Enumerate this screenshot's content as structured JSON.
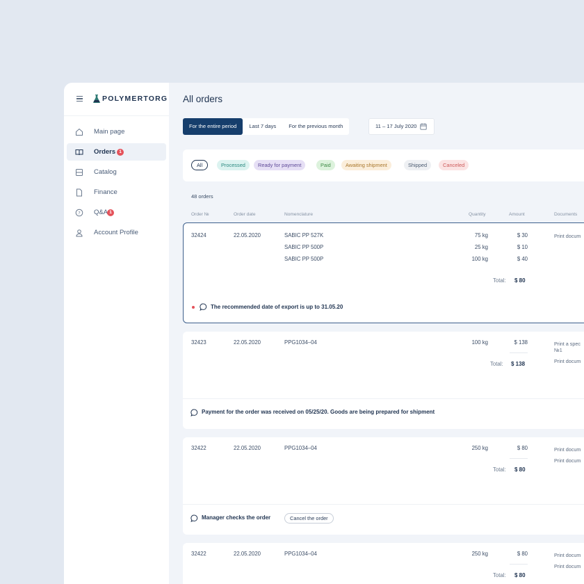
{
  "app": {
    "logo_text": "POLYMERTORG"
  },
  "sidebar": {
    "items": [
      {
        "label": "Main page",
        "icon": "home-icon"
      },
      {
        "label": "Orders",
        "icon": "book-icon",
        "badge": "1",
        "active": true
      },
      {
        "label": "Catalog",
        "icon": "catalog-icon"
      },
      {
        "label": "Finance",
        "icon": "file-icon"
      },
      {
        "label": "Q&A",
        "icon": "question-icon",
        "badge": "1"
      },
      {
        "label": "Account Profile",
        "icon": "user-icon"
      }
    ]
  },
  "main": {
    "title": "All orders",
    "periods": [
      "For the entire period",
      "Last 7 days",
      "For the previous month"
    ],
    "date_range": "11 – 17 July 2020",
    "filters": [
      "All",
      "Processed",
      "Ready for payment",
      "Paid",
      "Awaiting shipment",
      "Shipped",
      "Canceled"
    ],
    "orders_count": "48 orders",
    "columns": [
      "Order №",
      "Order date",
      "Nomenclature",
      "Quantity",
      "Amount",
      "Documents"
    ],
    "total_label": "Total:"
  },
  "colors": {
    "accent": "#163e6c",
    "badge_red": "#e4525a",
    "chip_processed_bg": "#dcf3f0",
    "chip_ready_bg": "#e6dff5",
    "chip_paid_bg": "#dcf2dc",
    "chip_awaiting_bg": "#fbeedb",
    "chip_shipped_bg": "#eef0f3",
    "chip_canceled_bg": "#fbe3e3"
  },
  "orders": [
    {
      "number": "32424",
      "date": "22.05.2020",
      "items": [
        {
          "name": "SABIC PP 527K",
          "qty": "75 kg",
          "amount": "$ 30"
        },
        {
          "name": "SABIC PP 500P",
          "qty": "25 kg",
          "amount": "$ 10"
        },
        {
          "name": "SABIC PP 500P",
          "qty": "100 kg",
          "amount": "$ 40"
        }
      ],
      "total": "$ 80",
      "documents": [
        "Print docum"
      ],
      "message": "The recommended date of export is up to 31.05.20"
    },
    {
      "number": "32423",
      "date": "22.05.2020",
      "items": [
        {
          "name": "PPG1034–04",
          "qty": "100 kg",
          "amount": "$ 138"
        }
      ],
      "total": "$ 138",
      "documents": [
        "Print a spec",
        "№1",
        "Print docum"
      ],
      "message": "Payment for the order was received on 05/25/20. Goods are being prepared for shipment"
    },
    {
      "number": "32422",
      "date": "22.05.2020",
      "items": [
        {
          "name": "PPG1034–04",
          "qty": "250 kg",
          "amount": "$ 80"
        }
      ],
      "total": "$ 80",
      "documents": [
        "Print docum",
        "Print docum"
      ],
      "message": "Manager checks the order",
      "action": "Cancel the order"
    },
    {
      "number": "32422",
      "date": "22.05.2020",
      "items": [
        {
          "name": "PPG1034–04",
          "qty": "250 kg",
          "amount": "$ 80"
        }
      ],
      "total": "$ 80",
      "documents": [
        "Print docum",
        "Print docum"
      ]
    }
  ]
}
